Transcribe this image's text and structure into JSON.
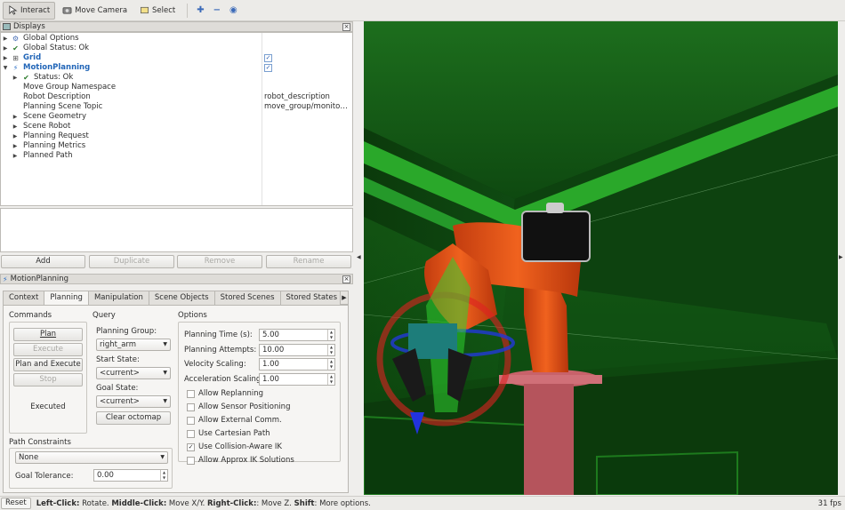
{
  "toolbar": {
    "interact": "Interact",
    "move_camera": "Move Camera",
    "select": "Select"
  },
  "displays": {
    "title": "Displays",
    "close": "×",
    "items": [
      {
        "label": "Global Options",
        "value": "",
        "icon": "gear-icon"
      },
      {
        "label": "Global Status: Ok",
        "value": "",
        "icon": "check-icon"
      },
      {
        "label": "Grid",
        "value": "",
        "icon": "grid-icon",
        "checked": true
      },
      {
        "label": "MotionPlanning",
        "value": "",
        "icon": "motion-planning-icon",
        "checked": true
      },
      {
        "label": "Status: Ok",
        "value": "",
        "icon": "check-icon"
      },
      {
        "label": "Move Group Namespace",
        "value": ""
      },
      {
        "label": "Robot Description",
        "value": "robot_description"
      },
      {
        "label": "Planning Scene Topic",
        "value": "move_group/monitor…"
      },
      {
        "label": "Scene Geometry",
        "value": ""
      },
      {
        "label": "Scene Robot",
        "value": ""
      },
      {
        "label": "Planning Request",
        "value": ""
      },
      {
        "label": "Planning Metrics",
        "value": ""
      },
      {
        "label": "Planned Path",
        "value": ""
      }
    ],
    "buttons": {
      "add": "Add",
      "duplicate": "Duplicate",
      "remove": "Remove",
      "rename": "Rename"
    }
  },
  "motion_planning": {
    "title": "MotionPlanning",
    "tabs": [
      "Context",
      "Planning",
      "Manipulation",
      "Scene Objects",
      "Stored Scenes",
      "Stored States"
    ],
    "active_tab": "Planning",
    "commands": {
      "heading": "Commands",
      "plan": "Plan",
      "execute": "Execute",
      "plan_and_execute": "Plan and Execute",
      "stop": "Stop",
      "status": "Executed"
    },
    "query": {
      "heading": "Query",
      "planning_group_label": "Planning Group:",
      "planning_group": "right_arm",
      "start_state_label": "Start State:",
      "start_state": "<current>",
      "goal_state_label": "Goal State:",
      "goal_state": "<current>",
      "clear_octomap": "Clear octomap"
    },
    "options": {
      "heading": "Options",
      "planning_time_label": "Planning Time (s):",
      "planning_time": "5.00",
      "planning_attempts_label": "Planning Attempts:",
      "planning_attempts": "10.00",
      "velocity_scaling_label": "Velocity Scaling:",
      "velocity_scaling": "1.00",
      "acceleration_scaling_label": "Acceleration Scaling:",
      "acceleration_scaling": "1.00",
      "checkboxes": [
        {
          "label": "Allow Replanning",
          "checked": false
        },
        {
          "label": "Allow Sensor Positioning",
          "checked": false
        },
        {
          "label": "Allow External Comm.",
          "checked": false
        },
        {
          "label": "Use Cartesian Path",
          "checked": false
        },
        {
          "label": "Use Collision-Aware IK",
          "checked": true
        },
        {
          "label": "Allow Approx IK Solutions",
          "checked": false
        }
      ]
    },
    "path_constraints": {
      "heading": "Path Constraints",
      "value": "None",
      "goal_tolerance_label": "Goal Tolerance:",
      "goal_tolerance": "0.00"
    }
  },
  "status_bar": {
    "reset": "Reset",
    "help_1b": "Left-Click:",
    "help_1": " Rotate. ",
    "help_2b": "Middle-Click:",
    "help_2": " Move X/Y. ",
    "help_3b": "Right-Click:",
    "help_3": ": Move Z. ",
    "help_4b": "Shift",
    "help_4": ": More options.",
    "fps": "31 fps"
  },
  "colors": {
    "robot": "#e8531c",
    "scene": "#1f8f1f",
    "accent": "#2266b8"
  }
}
